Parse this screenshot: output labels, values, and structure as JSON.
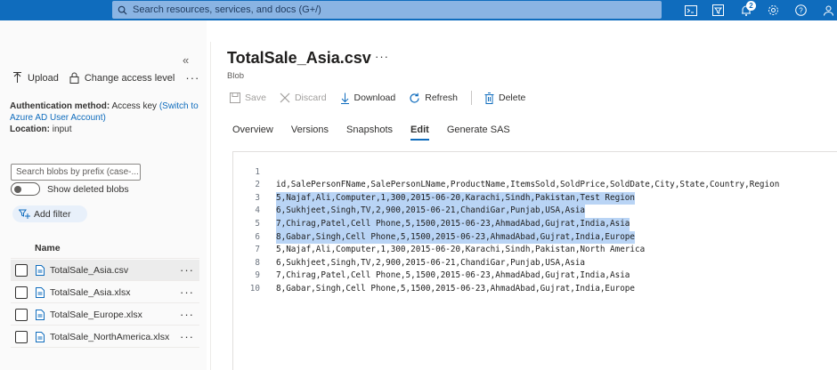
{
  "topbar": {
    "search_placeholder": "Search resources, services, and docs (G+/)",
    "notification_count": "2",
    "icons": [
      "terminal-icon",
      "filter-icon",
      "bell-icon",
      "gear-icon",
      "help-icon",
      "feedback-icon"
    ]
  },
  "left": {
    "upload_label": "Upload",
    "change_access_label": "Change access level",
    "more": "···",
    "auth_label": "Authentication method:",
    "auth_value": "Access key",
    "auth_link": "(Switch to Azure AD User Account)",
    "location_label": "Location:",
    "location_value": "input",
    "prefix_placeholder": "Search blobs by prefix (case-...",
    "show_deleted_label": "Show deleted blobs",
    "add_filter_label": "Add filter",
    "name_header": "Name",
    "blobs": [
      {
        "name": "TotalSale_Asia.csv",
        "more": "···"
      },
      {
        "name": "TotalSale_Asia.xlsx",
        "more": "···"
      },
      {
        "name": "TotalSale_Europe.xlsx",
        "more": "···"
      },
      {
        "name": "TotalSale_NorthAmerica.xlsx",
        "more": "···"
      }
    ],
    "collapse_glyph": "«"
  },
  "main": {
    "title": "TotalSale_Asia.csv",
    "title_more": "···",
    "subtitle": "Blob",
    "commands": {
      "save": "Save",
      "discard": "Discard",
      "download": "Download",
      "refresh": "Refresh",
      "delete": "Delete"
    },
    "tabs": [
      "Overview",
      "Versions",
      "Snapshots",
      "Edit",
      "Generate SAS"
    ],
    "active_tab": "Edit",
    "editor_lines": [
      {
        "n": "1",
        "text": "id,SalePersonFName,SalePersonLName,ProductName,ItemsSold,SoldPrice,SoldDate,City,State,Country,Region"
      },
      {
        "n": "2",
        "text": "5,Najaf,Ali,Computer,1,300,2015-06-20,Karachi,Sindh,Pakistan,Test Region"
      },
      {
        "n": "3",
        "text": "6,Sukhjeet,Singh,TV,2,900,2015-06-21,ChandiGar,Punjab,USA,Asia"
      },
      {
        "n": "4",
        "text": "7,Chirag,Patel,Cell Phone,5,1500,2015-06-23,AhmadAbad,Gujrat,India,Asia"
      },
      {
        "n": "5",
        "text": "8,Gabar,Singh,Cell Phone,5,1500,2015-06-23,AhmadAbad,Gujrat,India,Europe"
      },
      {
        "n": "6",
        "text": "5,Najaf,Ali,Computer,1,300,2015-06-20,Karachi,Sindh,Pakistan,North America"
      },
      {
        "n": "7",
        "text": "6,Sukhjeet,Singh,TV,2,900,2015-06-21,ChandiGar,Punjab,USA,Asia"
      },
      {
        "n": "8",
        "text": "7,Chirag,Patel,Cell Phone,5,1500,2015-06-23,AhmadAbad,Gujrat,India,Asia"
      },
      {
        "n": "9",
        "text": "8,Gabar,Singh,Cell Phone,5,1500,2015-06-23,AhmadAbad,Gujrat,India,Europe"
      },
      {
        "n": "10",
        "text": ""
      }
    ],
    "highlighted_lines": [
      "2",
      "3",
      "4",
      "5"
    ]
  },
  "colors": {
    "brand": "#0f6cbd",
    "selection": "#b9d4f5"
  }
}
